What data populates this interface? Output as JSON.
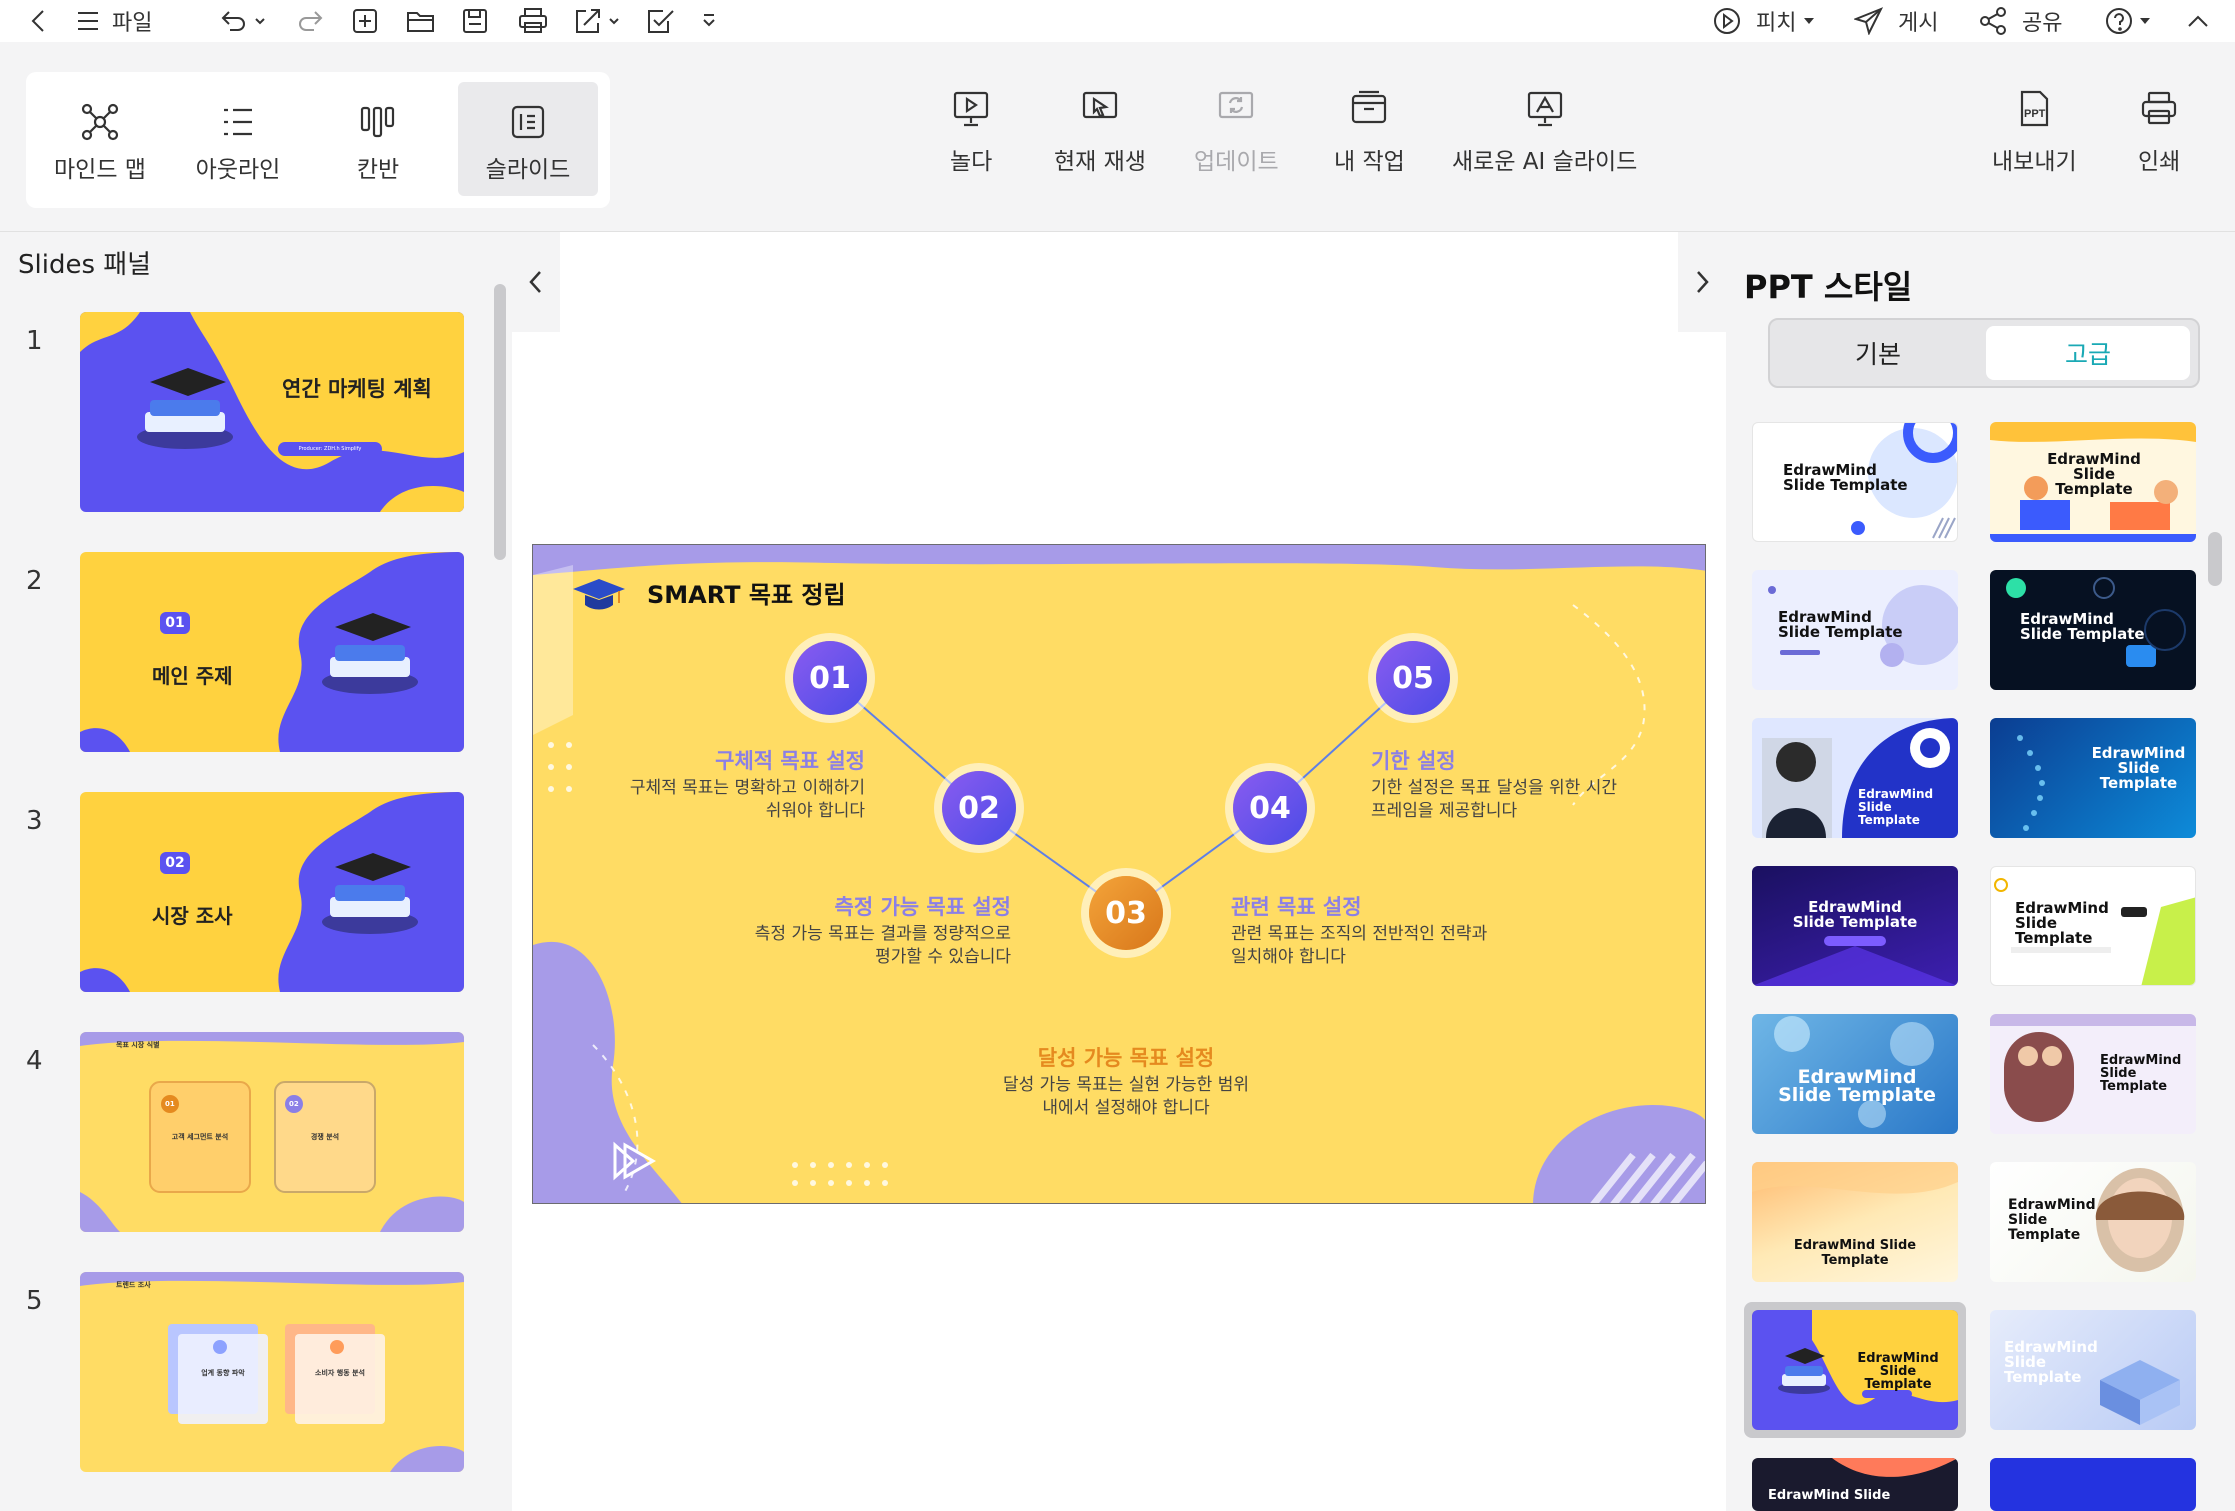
{
  "topbar": {
    "file_label": "파일",
    "pitch_label": "피치",
    "publish_label": "게시",
    "share_label": "공유"
  },
  "views": [
    {
      "label": "마인드 맵"
    },
    {
      "label": "아웃라인"
    },
    {
      "label": "칸반"
    },
    {
      "label": "슬라이드"
    }
  ],
  "ribbon": {
    "play": "놀다",
    "play_current": "현재 재생",
    "update": "업데이트",
    "my_work": "내 작업",
    "new_ai_slide": "새로운 AI 슬라이드",
    "export": "내보내기",
    "print": "인쇄"
  },
  "slides_panel": {
    "title": "Slides 패널",
    "slides": [
      {
        "num": "1",
        "title": "연간 마케팅 계획",
        "pill": "Producer: ZDH.h Simplify"
      },
      {
        "num": "2",
        "badge": "01",
        "title": "메인 주제"
      },
      {
        "num": "3",
        "badge": "02",
        "title": "시장 조사"
      },
      {
        "num": "4",
        "header": "목표 시장 식별",
        "cards": [
          {
            "badge": "01",
            "title": "고객 세그먼트 분석"
          },
          {
            "badge": "02",
            "title": "경쟁 분석"
          }
        ]
      },
      {
        "num": "5",
        "header": "트렌드 조사",
        "cards": [
          {
            "title": "업계 동향 파악"
          },
          {
            "title": "소비자 행동 분석"
          }
        ]
      }
    ]
  },
  "slide": {
    "title": "SMART 목표 정립",
    "steps": [
      {
        "num": "01",
        "heading": "구체적 목표 설정",
        "line1": "구체적 목표는 명확하고 이해하기",
        "line2": "쉬워야 합니다"
      },
      {
        "num": "02",
        "heading": "측정 가능 목표 설정",
        "line1": "측정 가능 목표는 결과를 정량적으로",
        "line2": "평가할 수 있습니다"
      },
      {
        "num": "03",
        "heading": "달성 가능 목표 설정",
        "line1": "달성 가능 목표는 실현 가능한 범위",
        "line2": "내에서 설정해야 합니다"
      },
      {
        "num": "04",
        "heading": "관련 목표 설정",
        "line1": "관련 목표는 조직의 전반적인 전략과",
        "line2": "일치해야 합니다"
      },
      {
        "num": "05",
        "heading": "기한 설정",
        "line1": "기한 설정은 목표 달성을 위한 시간",
        "line2": "프레임을 제공합니다"
      }
    ]
  },
  "style_panel": {
    "title": "PPT 스타일",
    "tab_basic": "기본",
    "tab_advanced": "고급",
    "templates": [
      {
        "name": "EdrawMind Slide Template"
      },
      {
        "name": "EdrawMind Slide Template"
      },
      {
        "name": "EdrawMind Slide Template"
      },
      {
        "name": "EdrawMind Slide Template"
      },
      {
        "name": "EdrawMind Slide Template"
      },
      {
        "name": "EdrawMind Slide Template"
      },
      {
        "name": "EdrawMind Slide Template"
      },
      {
        "name": "EdrawMind Slide Template"
      },
      {
        "name": "EdrawMind Slide Template"
      },
      {
        "name": "EdrawMind Slide Template"
      },
      {
        "name": "EdrawMind Slide Template"
      },
      {
        "name": "EdrawMind Slide Template"
      },
      {
        "name": "EdrawMind Slide Template"
      },
      {
        "name": "EdrawMind Slide Template"
      },
      {
        "name": "EdrawMind Slide"
      }
    ]
  },
  "colors": {
    "accent": "#1aa9b5",
    "slide_yellow": "#ffdc64",
    "slide_purple": "#5b52f0",
    "step_orange": "#e58a1f"
  }
}
